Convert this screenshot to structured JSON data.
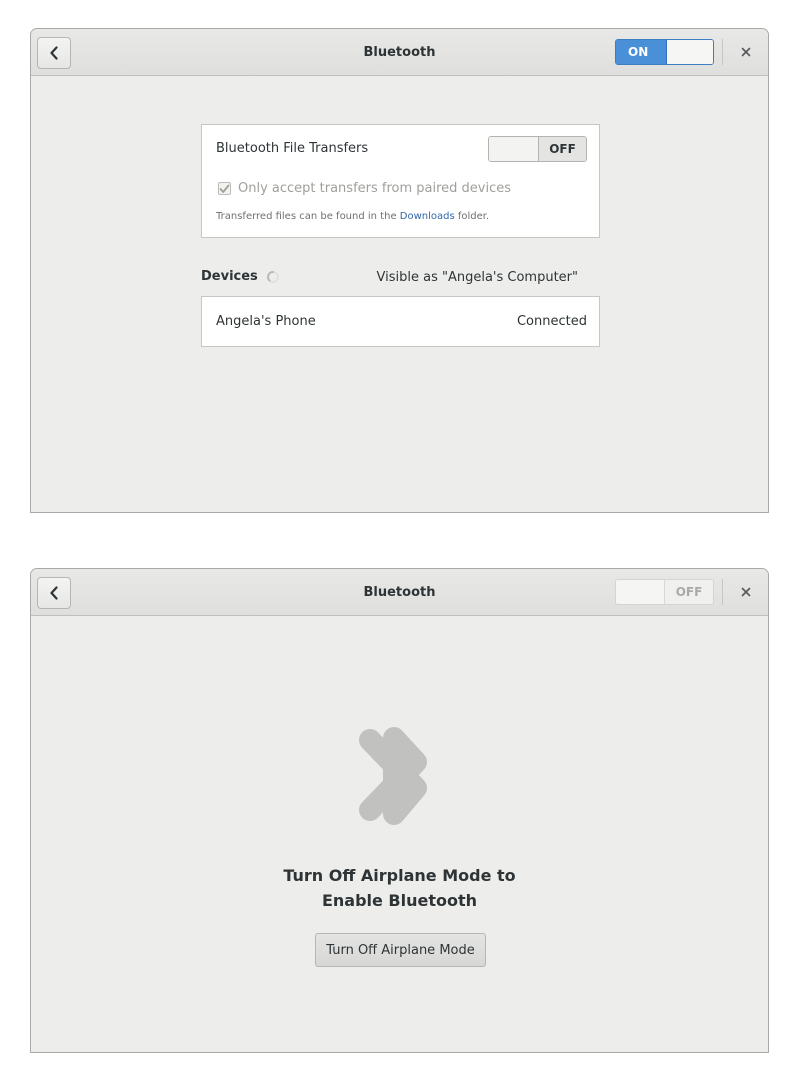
{
  "window_top": {
    "title": "Bluetooth",
    "power_switch": {
      "state": "on",
      "label": "ON"
    },
    "file_transfers": {
      "label": "Bluetooth File Transfers",
      "switch_label": "OFF",
      "checkbox_label": "Only accept transfers from paired devices",
      "checkbox_checked": true,
      "hint_prefix": "Transferred files can be found in the ",
      "hint_link": "Downloads",
      "hint_suffix": " folder."
    },
    "devices": {
      "heading": "Devices",
      "visible_as": "Visible as \"Angela's Computer\"",
      "list": [
        {
          "name": "Angela's Phone",
          "status": "Connected"
        }
      ]
    }
  },
  "window_bottom": {
    "title": "Bluetooth",
    "power_switch": {
      "state": "off",
      "label": "OFF"
    },
    "message_line1": "Turn Off Airplane Mode to",
    "message_line2": "Enable Bluetooth",
    "button_label": "Turn Off Airplane Mode"
  },
  "icons": {
    "back": "chevron-left-icon",
    "close": "close-icon",
    "bluetooth": "bluetooth-icon",
    "spinner": "spinner-icon",
    "check": "checkmark-icon"
  },
  "colors": {
    "accent": "#4a90d9",
    "link": "#3468a7",
    "window_bg": "#ededeb",
    "bt_icon": "#c1c1bf"
  }
}
